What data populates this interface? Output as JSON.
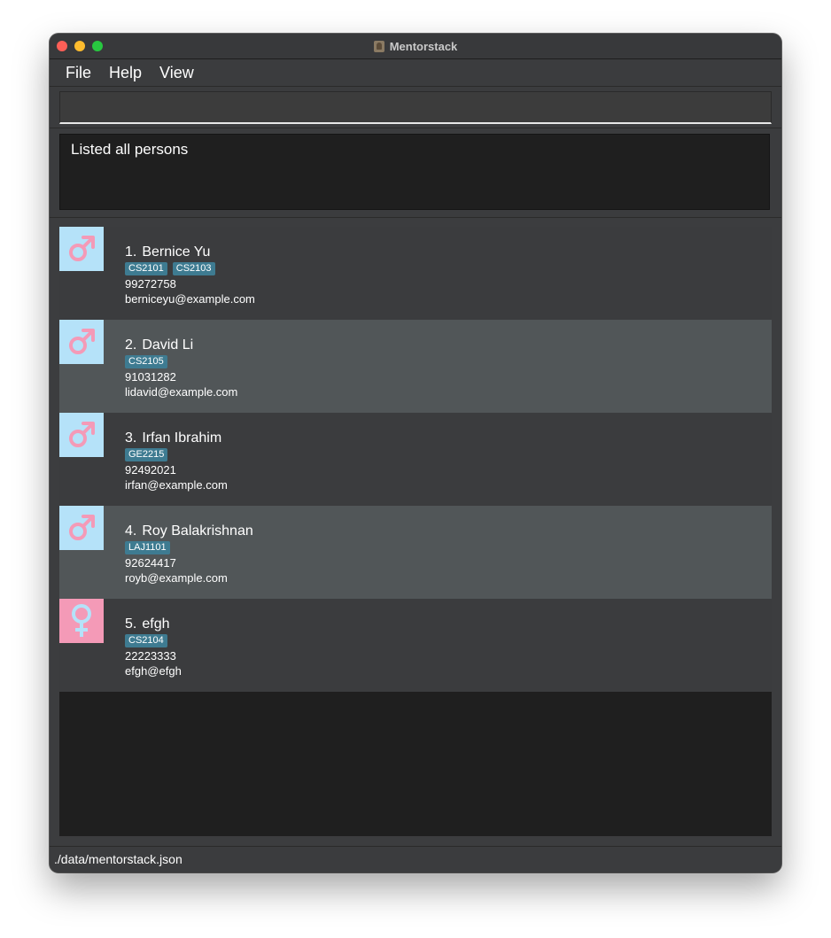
{
  "window": {
    "title": "Mentorstack"
  },
  "menu": {
    "items": [
      "File",
      "Help",
      "View"
    ]
  },
  "command": {
    "value": ""
  },
  "result": {
    "text": "Listed all persons"
  },
  "persons": [
    {
      "index": "1.",
      "name": "Bernice Yu",
      "gender": "male",
      "tags": [
        "CS2101",
        "CS2103"
      ],
      "phone": "99272758",
      "email": "berniceyu@example.com"
    },
    {
      "index": "2.",
      "name": "David Li",
      "gender": "male",
      "tags": [
        "CS2105"
      ],
      "phone": "91031282",
      "email": "lidavid@example.com"
    },
    {
      "index": "3.",
      "name": "Irfan Ibrahim",
      "gender": "male",
      "tags": [
        "GE2215"
      ],
      "phone": "92492021",
      "email": "irfan@example.com"
    },
    {
      "index": "4.",
      "name": "Roy Balakrishnan",
      "gender": "male",
      "tags": [
        "LAJ1101"
      ],
      "phone": "92624417",
      "email": "royb@example.com"
    },
    {
      "index": "5.",
      "name": "efgh",
      "gender": "female",
      "tags": [
        "CS2104"
      ],
      "phone": "22223333",
      "email": "efgh@efgh"
    }
  ],
  "status": {
    "path": "./data/mentorstack.json"
  },
  "colors": {
    "male_bg": "#b5e2f9",
    "female_bg": "#f49ab7",
    "symbol": "#f49ab7",
    "tag_bg": "#3e7b91"
  },
  "icons": {
    "male": "male-symbol-icon",
    "female": "female-symbol-icon"
  }
}
